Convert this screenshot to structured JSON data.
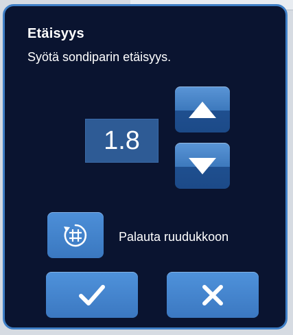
{
  "dialog": {
    "title": "Etäisyys",
    "subtitle": "Syötä sondiparin etäisyys."
  },
  "distance": {
    "value": "1.8"
  },
  "stepper": {
    "up_icon": "triangle-up-icon",
    "down_icon": "triangle-down-icon"
  },
  "reset": {
    "icon": "grid-reset-icon",
    "label": "Palauta ruudukkoon"
  },
  "actions": {
    "confirm_icon": "checkmark-icon",
    "cancel_icon": "close-x-icon"
  },
  "colors": {
    "dialog_background": "#0a1430",
    "dialog_border": "#3f7fc6",
    "button_blue": "#4a8bd3",
    "value_box": "#2e5b95"
  }
}
